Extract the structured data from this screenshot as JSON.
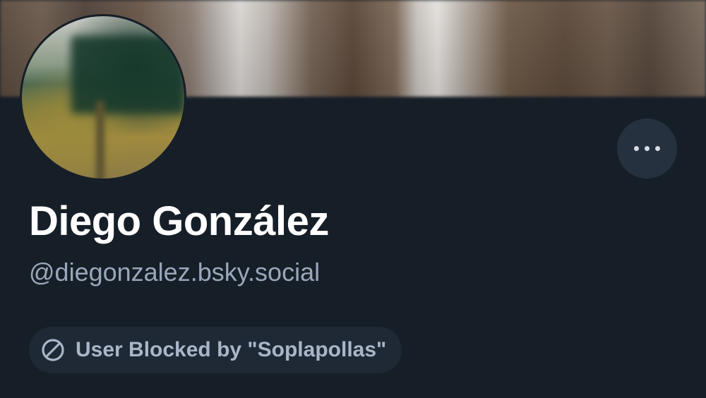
{
  "profile": {
    "display_name": "Diego González",
    "handle": "@diegonzalez.bsky.social",
    "blocked_label": "User Blocked by \"Soplapollas\""
  },
  "icons": {
    "banner": "banner-image",
    "avatar": "avatar-image",
    "more": "ellipsis-icon",
    "blocked": "block-icon"
  },
  "colors": {
    "background": "#161e27",
    "name": "#ffffff",
    "handle": "#9aa7ba",
    "pill_background": "#1f2935",
    "pill_text": "#aab6c8",
    "more_button": "#263140"
  }
}
